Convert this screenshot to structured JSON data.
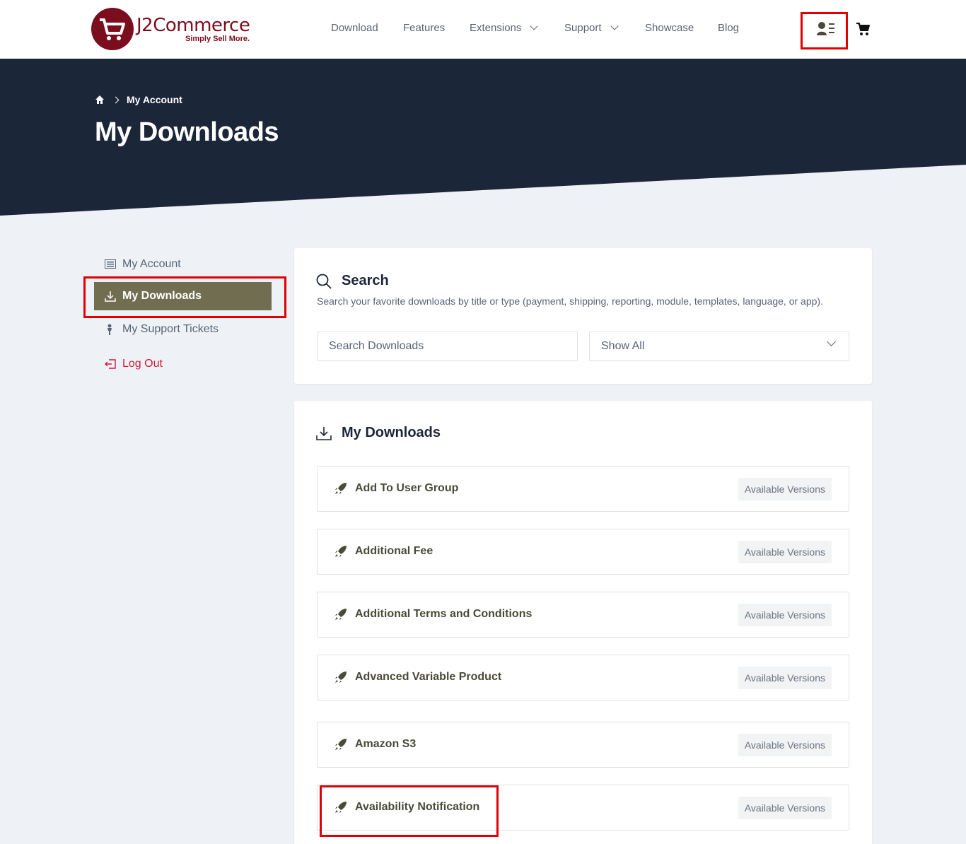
{
  "header": {
    "logo_text": "J2Commerce",
    "logo_tagline": "Simply Sell More.",
    "nav": [
      {
        "label": "Download",
        "dropdown": false
      },
      {
        "label": "Features",
        "dropdown": false
      },
      {
        "label": "Extensions",
        "dropdown": true
      },
      {
        "label": "Support",
        "dropdown": true
      },
      {
        "label": "Showcase",
        "dropdown": false
      },
      {
        "label": "Blog",
        "dropdown": false
      }
    ],
    "user_icon": "user-list-icon",
    "cart_icon": "cart-icon"
  },
  "hero": {
    "breadcrumb": [
      "home-icon",
      "My Account"
    ],
    "title": "My Downloads",
    "bg_color": "#1c2639"
  },
  "sidebar": {
    "items": [
      {
        "label": "My Account",
        "icon": "list-icon"
      },
      {
        "label": "My Downloads",
        "icon": "download-icon",
        "active": true
      },
      {
        "label": "My Support Tickets",
        "icon": "person-icon"
      },
      {
        "label": "Log Out",
        "icon": "logout-icon"
      }
    ]
  },
  "search": {
    "heading": "Search",
    "description": "Search your favorite downloads by title or type (payment, shipping, reporting, module, templates, language, or app).",
    "input_placeholder": "Search Downloads",
    "filter_value": "Show All"
  },
  "downloads": {
    "heading": "My Downloads",
    "badge_label": "Available Versions",
    "items": [
      "Add To User Group",
      "Additional Fee",
      "Additional Terms and Conditions",
      "Advanced Variable Product",
      "Amazon S3",
      "Availability Notification"
    ]
  },
  "colors": {
    "brand": "#7b0d1e",
    "active": "#716d50",
    "highlight": "#e00000",
    "logout": "#d4183d"
  }
}
